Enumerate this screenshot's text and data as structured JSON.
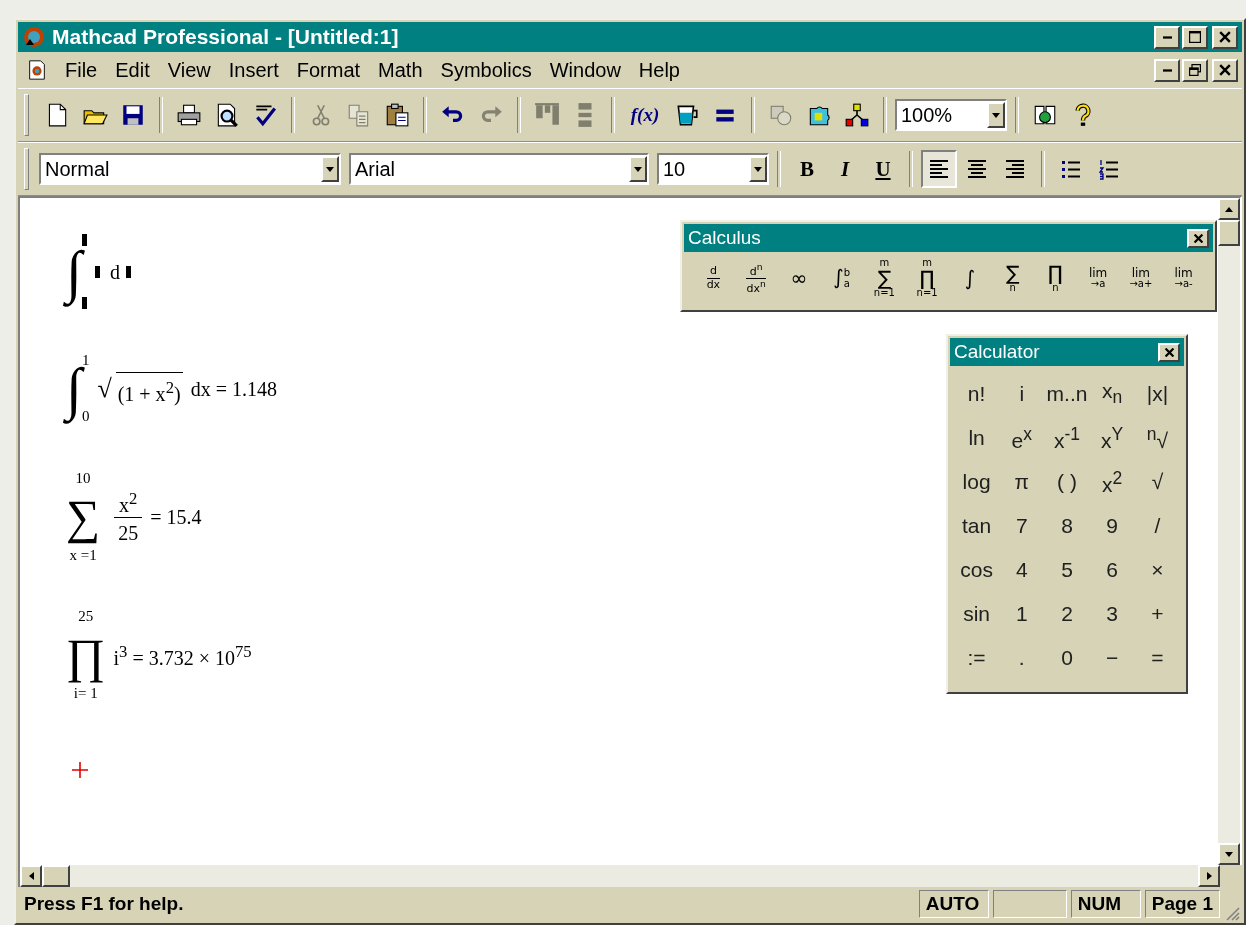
{
  "window": {
    "title": "Mathcad Professional - [Untitled:1]"
  },
  "menu": [
    "File",
    "Edit",
    "View",
    "Insert",
    "Format",
    "Math",
    "Symbolics",
    "Window",
    "Help"
  ],
  "standard_toolbar": {
    "groups": [
      [
        {
          "kind": "button",
          "disabled": false
        },
        {
          "kind": "button",
          "disabled": false
        },
        {
          "kind": "button",
          "disabled": false
        }
      ],
      [
        {
          "kind": "button",
          "disabled": false
        },
        {
          "kind": "button",
          "disabled": false
        },
        {
          "kind": "button",
          "disabled": false
        }
      ],
      [
        {
          "kind": "button",
          "disabled": true
        },
        {
          "kind": "button",
          "disabled": true
        },
        {
          "kind": "button",
          "disabled": false
        }
      ],
      [
        {
          "kind": "button",
          "disabled": false
        },
        {
          "kind": "button",
          "disabled": true
        }
      ],
      [
        {
          "kind": "button",
          "disabled": true
        },
        {
          "kind": "button",
          "disabled": true
        }
      ],
      [
        {
          "kind": "text_button",
          "label": "f(x)",
          "disabled": false
        },
        {
          "kind": "button",
          "disabled": false
        },
        {
          "kind": "button",
          "disabled": false
        }
      ],
      [
        {
          "kind": "button",
          "disabled": true
        },
        {
          "kind": "button",
          "disabled": false
        },
        {
          "kind": "button",
          "disabled": false
        }
      ],
      [
        {
          "kind": "combo",
          "value": "100%"
        }
      ],
      [
        {
          "kind": "button",
          "disabled": false
        },
        {
          "kind": "button",
          "disabled": false
        }
      ]
    ]
  },
  "format_toolbar": {
    "style": "Normal",
    "font": "Arial",
    "size": "10",
    "char_buttons": [
      "B",
      "I",
      "U"
    ],
    "align_buttons": [
      {
        "selected": true
      },
      {
        "selected": false
      },
      {
        "selected": false
      }
    ]
  },
  "worksheet": {
    "regions": [
      {
        "kind": "placeholder",
        "symbol": "∫",
        "differential": "d"
      },
      {
        "kind": "radical",
        "symbol": "∫",
        "upper": "1",
        "lower": "0",
        "radical": "√",
        "radicand": "(1 + x$^{2}$)",
        "tail": "dx = 1.148"
      },
      {
        "kind": "fraction",
        "symbol": "∑",
        "upper": "10",
        "lower": "x =1",
        "numerator": "x$^{2}$",
        "denominator": "25",
        "tail": "= 15.4"
      },
      {
        "kind": "plain",
        "symbol": "∏",
        "upper": "25",
        "lower": "i= 1",
        "tail": "i$^{3}$ = 3.732 × 10$^{75}$"
      }
    ]
  },
  "calculus_palette": {
    "title": "Calculus",
    "buttons": [
      {
        "kind": "fraction",
        "upper": "d",
        "lower": "dx"
      },
      {
        "kind": "fraction",
        "upper": "d$^{n}$",
        "lower": "dx$^{n}$"
      },
      {
        "kind": "operator",
        "symbol": "∞"
      },
      {
        "kind": "integral",
        "symbol": "∫",
        "upper": "b",
        "lower": "a"
      },
      {
        "kind": "operator",
        "symbol": "∑",
        "upper": "m",
        "lower": "n=1"
      },
      {
        "kind": "operator",
        "symbol": "∏",
        "upper": "m",
        "lower": "n=1"
      },
      {
        "kind": "operator",
        "symbol": "∫"
      },
      {
        "kind": "operator",
        "symbol": "∑",
        "lower": "n"
      },
      {
        "kind": "operator",
        "symbol": "∏",
        "lower": "n"
      },
      {
        "kind": "operator",
        "symbol": "lim",
        "lower": "→a"
      },
      {
        "kind": "operator",
        "symbol": "lim",
        "lower": "→a+"
      },
      {
        "kind": "operator",
        "symbol": "lim",
        "lower": "→a-"
      }
    ]
  },
  "calculator_palette": {
    "title": "Calculator",
    "keys": [
      "n!",
      "i",
      "m..n",
      "x$_{n}$",
      "|x|",
      "ln",
      "e$^{x}$",
      "x$^{-1}$",
      "x$^{Y}$",
      "$^{n}$√",
      "log",
      "π",
      "( )",
      "x$^{2}$",
      "√",
      "tan",
      "7",
      "8",
      "9",
      "/",
      "cos",
      "4",
      "5",
      "6",
      "×",
      "sin",
      "1",
      "2",
      "3",
      "+",
      ":=",
      ".",
      "0",
      "−",
      "="
    ]
  },
  "status_bar": {
    "message": "Press F1 for help.",
    "panes": [
      {
        "kind": "text",
        "text": "AUTO"
      },
      {
        "kind": "blank"
      },
      {
        "kind": "text",
        "text": "NUM"
      },
      {
        "kind": "text",
        "text": "Page 1"
      }
    ]
  }
}
